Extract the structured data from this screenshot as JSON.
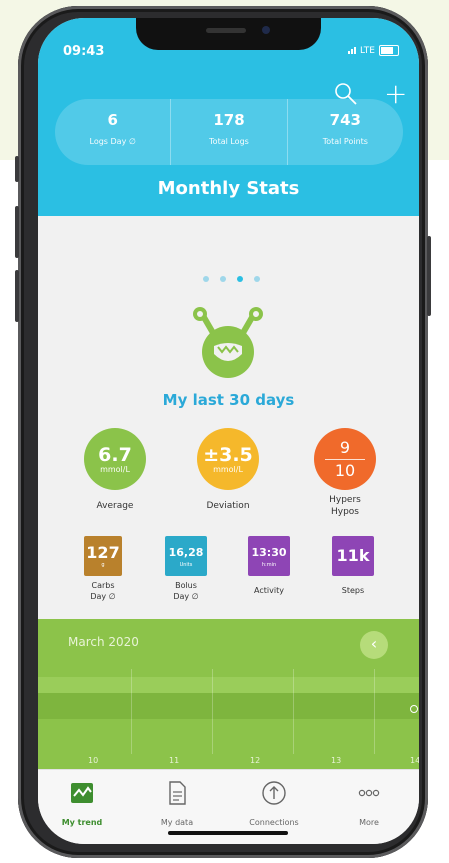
{
  "status": {
    "time": "09:43",
    "network": "LTE"
  },
  "stats": [
    {
      "value": "6",
      "label": "Logs Day ∅"
    },
    {
      "value": "178",
      "label": "Total Logs"
    },
    {
      "value": "743",
      "label": "Total Points"
    }
  ],
  "header": {
    "title": "Monthly Stats"
  },
  "page": {
    "subtitle": "My last 30 days",
    "page_indicator": {
      "count": 4,
      "active_index": 2
    }
  },
  "metrics": {
    "average": {
      "value": "6.7",
      "unit": "mmol/L",
      "label": "Average",
      "color": "#8bc34a"
    },
    "deviation": {
      "value": "±3.5",
      "unit": "mmol/L",
      "label": "Deviation",
      "color": "#f5b82b"
    },
    "hypers_hypos": {
      "hypers": "9",
      "hypos": "10",
      "label_top": "Hypers",
      "label_bottom": "Hypos",
      "color": "#f06a2b"
    }
  },
  "tiles": {
    "carbs": {
      "value": "127",
      "unit": "g",
      "label_top": "Carbs",
      "label_bottom": "Day ∅",
      "color": "#b9812c"
    },
    "bolus": {
      "value": "16,28",
      "unit": "Units",
      "label_top": "Bolus",
      "label_bottom": "Day ∅",
      "color": "#2ba9c9"
    },
    "activity": {
      "value": "13:30",
      "unit": "h:min",
      "label": "Activity",
      "color": "#8e45b5"
    },
    "steps": {
      "value": "11k",
      "label": "Steps",
      "color": "#8e45b5"
    }
  },
  "trend": {
    "month": "March 2020",
    "days": [
      "10",
      "11",
      "12",
      "13",
      "14"
    ],
    "color": "#8cc34a"
  },
  "tabs": [
    {
      "label": "My trend",
      "icon": "trend-icon",
      "active": true
    },
    {
      "label": "My data",
      "icon": "document-icon",
      "active": false
    },
    {
      "label": "Connections",
      "icon": "upload-icon",
      "active": false
    },
    {
      "label": "More",
      "icon": "more-dots-icon",
      "active": false
    }
  ]
}
